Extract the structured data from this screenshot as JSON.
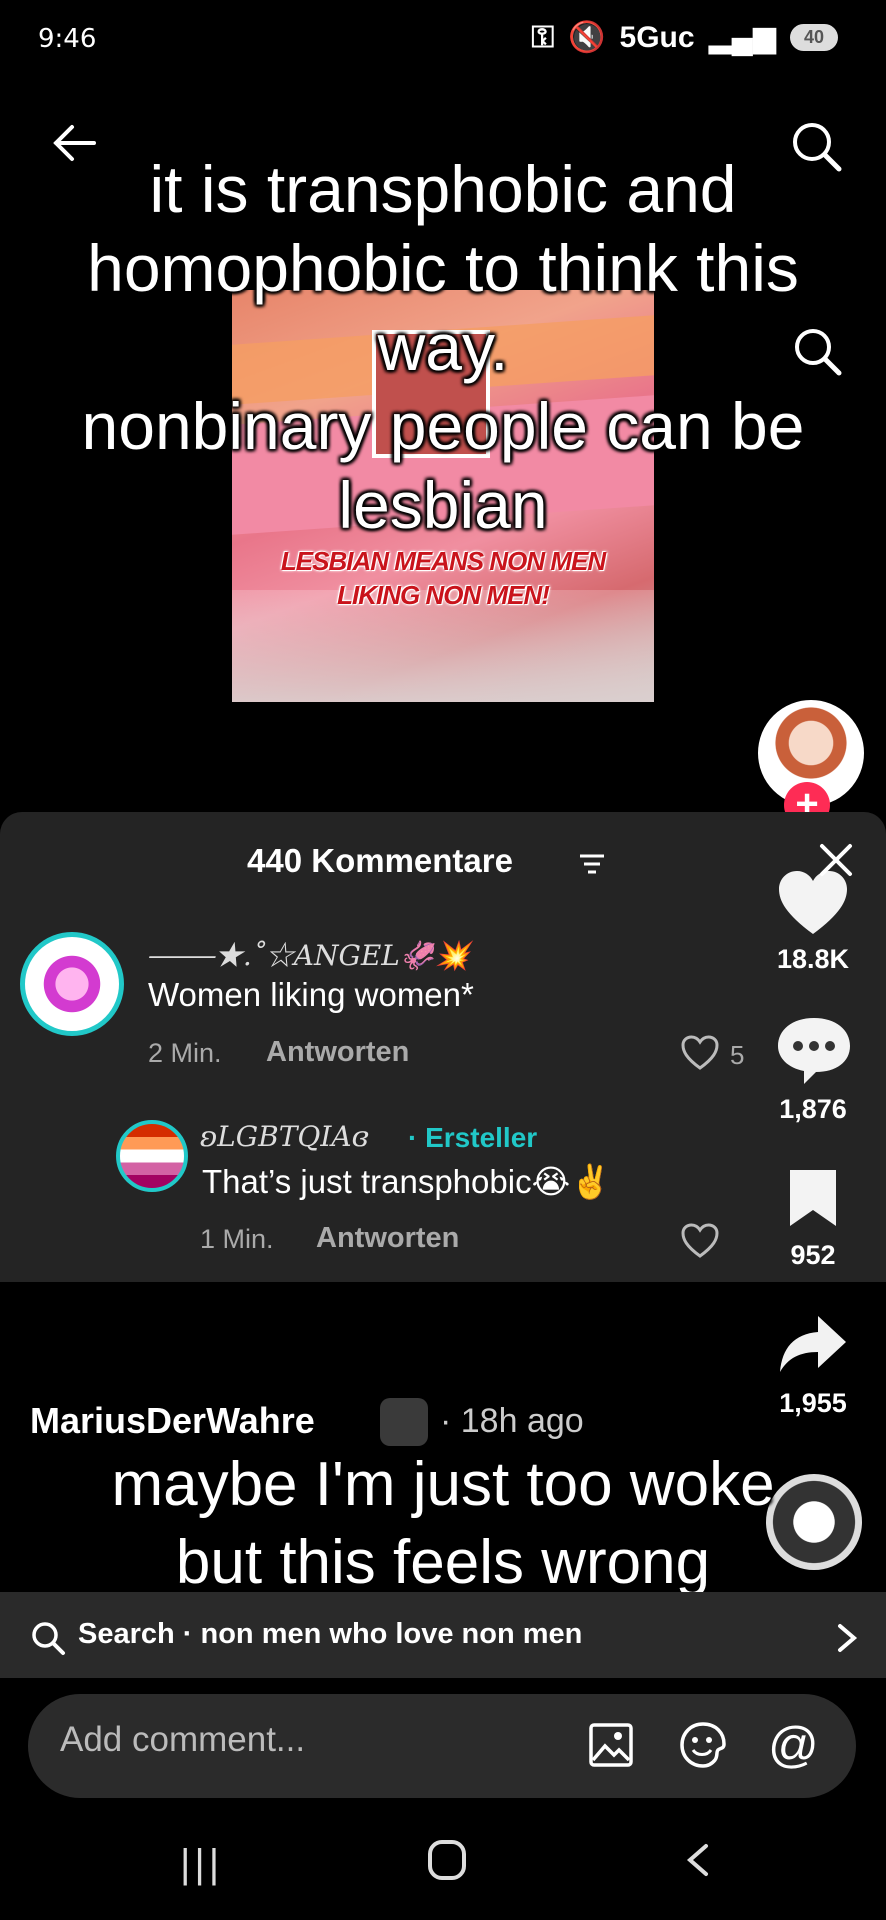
{
  "status_bar": {
    "time": "9:46",
    "network": "5Guc",
    "battery": "40"
  },
  "video": {
    "overlay_text": "it is transphobic and homophobic to think this way.\nnonbinary people can be lesbian",
    "meme_caption": "LESBIAN MEANS NON MEN\nLIKING NON MEN!",
    "bottom_overlay_text": "maybe I'm just too woke\nbut this feels wrong"
  },
  "comments_panel": {
    "title": "440 Kommentare",
    "comments": [
      {
        "username": "⸻★.˚☆ANGEL🦑💥",
        "text": "Women liking women*",
        "time": "2 Min.",
        "reply_label": "Antworten",
        "likes": "5"
      },
      {
        "username": "ʚLGBTQIAɞ",
        "creator_label": "· Ersteller",
        "text": "That’s just transphobic😭✌️",
        "time": "1 Min.",
        "reply_label": "Antworten"
      }
    ]
  },
  "rail": {
    "like_count": "18.8K",
    "comment_count": "1,876",
    "save_count": "952",
    "share_count": "1,955"
  },
  "post": {
    "author": "MariusDerWahre",
    "time": "· 18h ago"
  },
  "search_bar": {
    "text": "Search · non men who love non men"
  },
  "comment_input": {
    "placeholder": "Add comment...",
    "at_symbol": "@"
  },
  "system_nav": {
    "recent_glyph": "|||"
  },
  "colors": {
    "accent_teal": "#21c8c8",
    "tiktok_red": "#fe2c55"
  }
}
